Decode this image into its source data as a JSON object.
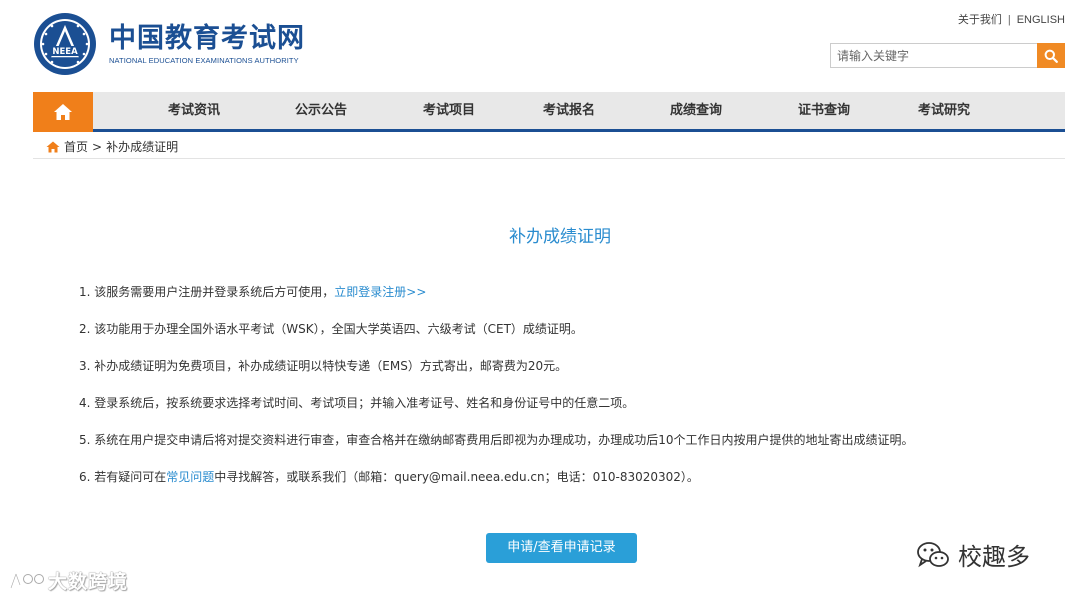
{
  "header": {
    "logo_cn": "中国教育考试网",
    "logo_en": "NATIONAL EDUCATION EXAMINATIONS AUTHORITY",
    "logo_badge": "NEEA",
    "toplinks": {
      "about": "关于我们",
      "separator": "|",
      "english": "ENGLISH"
    },
    "search": {
      "placeholder": "请输入关键字",
      "icon": "search-icon"
    }
  },
  "nav": {
    "home_icon": "home-icon",
    "items": [
      {
        "label": "考试资讯"
      },
      {
        "label": "公示公告"
      },
      {
        "label": "考试项目"
      },
      {
        "label": "考试报名"
      },
      {
        "label": "成绩查询"
      },
      {
        "label": "证书查询"
      },
      {
        "label": "考试研究"
      }
    ],
    "accent_color": "#f07f1a",
    "underline_color": "#1b4f93"
  },
  "breadcrumb": {
    "home": "首页",
    "arrow": ">",
    "current": "补办成绩证明"
  },
  "main": {
    "title": "补办成绩证明",
    "items": [
      {
        "text": "1. 该服务需要用户注册并登录系统后方可使用，",
        "link": "立即登录注册>>"
      },
      {
        "text": "2. 该功能用于办理全国外语水平考试（WSK），全国大学英语四、六级考试（CET）成绩证明。"
      },
      {
        "text": "3. 补办成绩证明为免费项目，补办成绩证明以特快专递（EMS）方式寄出，邮寄费为20元。"
      },
      {
        "text": "4. 登录系统后，按系统要求选择考试时间、考试项目；并输入准考证号、姓名和身份证号中的任意二项。"
      },
      {
        "text": "5. 系统在用户提交申请后将对提交资料进行审查，审查合格并在缴纳邮寄费用后即视为办理成功，办理成功后10个工作日内按用户提供的地址寄出成绩证明。"
      },
      {
        "prefix": "6. 若有疑问可在",
        "link": "常见问题",
        "suffix": "中寻找解答，或联系我们（邮箱：query@mail.neea.edu.cn；电话：010-83020302）。"
      }
    ],
    "apply_button": "申请/查看申请记录",
    "link_color": "#2a8ccf",
    "button_color": "#2a9fd8"
  },
  "watermarks": {
    "left": "大数跨境",
    "right": "校趣多"
  }
}
